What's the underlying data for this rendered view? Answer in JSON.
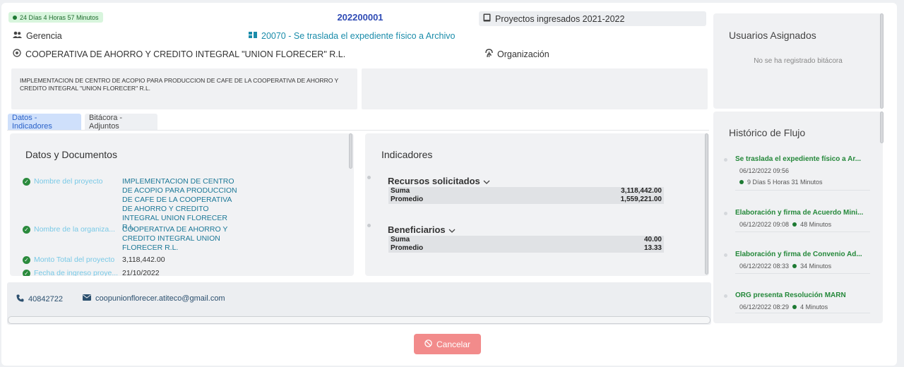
{
  "header": {
    "timer": "24 Días 4 Horas 57 Minutos",
    "code": "202200001",
    "projects_label": "Proyectos ingresados 2021-2022",
    "unit_label": "Gerencia",
    "step_link": "20070 - Se traslada el expediente físico a Archivo",
    "organization_name": "COOPERATIVA DE AHORRO Y CREDITO INTEGRAL \"UNION FLORECER\" R.L.",
    "organization_label": "Organización",
    "description": "IMPLEMENTACION DE CENTRO DE ACOPIO PARA PRODUCCION DE CAFE DE LA COOPERATIVA DE AHORRO Y CREDITO INTEGRAL \"UNION FLORECER\" R.L."
  },
  "tabs": [
    {
      "label": "Datos - Indicadores",
      "active": true
    },
    {
      "label": "Bitácora - Adjuntos",
      "active": false
    }
  ],
  "datos": {
    "title": "Datos y Documentos",
    "fields": [
      {
        "label": "Nombre del proyecto",
        "value": "IMPLEMENTACION DE CENTRO DE ACOPIO PARA PRODUCCION DE CAFE DE LA COOPERATIVA DE AHORRO Y CREDITO INTEGRAL UNION FLORECER R.L."
      },
      {
        "label": "Nombre de la organiza...",
        "value": "COOPERATIVA DE AHORRO Y CREDITO INTEGRAL UNION FLORECER R.L."
      },
      {
        "label": "Monto Total del proyecto",
        "value": "3,118,442.00"
      },
      {
        "label": "Fecha de ingreso proye...",
        "value": "21/10/2022"
      }
    ]
  },
  "indicadores": {
    "title": "Indicadores",
    "groups": [
      {
        "title": "Recursos solicitados",
        "rows": [
          {
            "label": "Suma",
            "value": "3,118,442.00"
          },
          {
            "label": "Promedio",
            "value": "1,559,221.00"
          }
        ]
      },
      {
        "title": "Beneficiarios",
        "rows": [
          {
            "label": "Suma",
            "value": "40.00"
          },
          {
            "label": "Promedio",
            "value": "13.33"
          }
        ]
      }
    ]
  },
  "contact": {
    "phone": "40842722",
    "email": "coopunionflorecer.atiteco@gmail.com"
  },
  "users": {
    "title": "Usuarios Asignados",
    "empty": "No se ha registrado bitácora"
  },
  "historico": {
    "title": "Histórico de Flujo",
    "items": [
      {
        "title": "Se traslada el expediente físico a Ar...",
        "date": "06/12/2022 09:56",
        "duration": "9 Días 5 Horas 31 Minutos"
      },
      {
        "title": "Elaboración y firma de Acuerdo Mini...",
        "date": "06/12/2022 09:08",
        "duration": "48 Minutos"
      },
      {
        "title": "Elaboración y firma de Convenio Ad...",
        "date": "06/12/2022 08:33",
        "duration": "34 Minutos"
      },
      {
        "title": "ORG presenta Resolución MARN",
        "date": "06/12/2022 08:29",
        "duration": "4 Minutos"
      }
    ]
  },
  "actions": {
    "cancel": "Cancelar"
  },
  "colors": {
    "accent_blue": "#2f4bb5",
    "link": "#1a8caa",
    "success": "#24883a",
    "cancel": "#f28b8b"
  }
}
